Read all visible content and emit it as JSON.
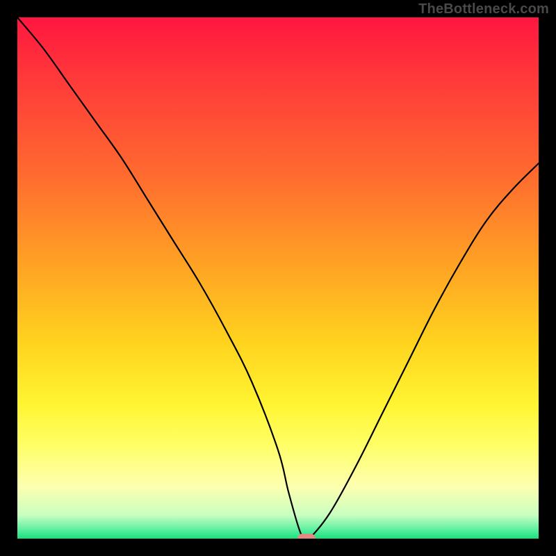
{
  "watermark": "TheBottleneck.com",
  "colors": {
    "frame": "#000000",
    "watermark_text": "#4a4a4a",
    "curve_stroke": "#000000",
    "dip_marker": "#e08a83",
    "gradient_stops": [
      {
        "offset": 0.0,
        "color": "#ff163f"
      },
      {
        "offset": 0.12,
        "color": "#ff3a3a"
      },
      {
        "offset": 0.3,
        "color": "#ff6a2f"
      },
      {
        "offset": 0.48,
        "color": "#ffa424"
      },
      {
        "offset": 0.62,
        "color": "#ffd21e"
      },
      {
        "offset": 0.74,
        "color": "#fff431"
      },
      {
        "offset": 0.82,
        "color": "#ffff66"
      },
      {
        "offset": 0.9,
        "color": "#fdffb0"
      },
      {
        "offset": 0.955,
        "color": "#c9ffc0"
      },
      {
        "offset": 0.982,
        "color": "#5ff0a0"
      },
      {
        "offset": 1.0,
        "color": "#18e07e"
      }
    ]
  },
  "chart_data": {
    "type": "line",
    "title": "",
    "xlabel": "",
    "ylabel": "",
    "xlim": [
      0,
      100
    ],
    "ylim": [
      0,
      100
    ],
    "series": [
      {
        "name": "bottleneck-curve",
        "x": [
          0,
          5,
          10,
          15,
          20,
          25,
          30,
          35,
          40,
          45,
          50,
          52,
          54,
          55,
          56,
          60,
          65,
          70,
          75,
          80,
          85,
          90,
          95,
          100
        ],
        "y": [
          100,
          94,
          87,
          80,
          73,
          65,
          57,
          49,
          40,
          30,
          17,
          9,
          2,
          0,
          0,
          5,
          14,
          24,
          34,
          44,
          53,
          61,
          67,
          72
        ]
      }
    ],
    "dip_marker": {
      "x": 55.5,
      "y": 0,
      "width_pct": 3.5,
      "height_pct": 1.8
    }
  }
}
